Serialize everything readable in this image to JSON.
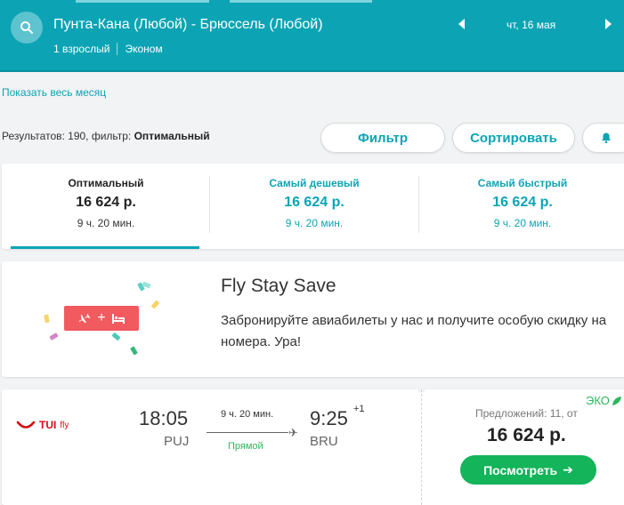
{
  "header": {
    "route": "Пунта-Кана (Любой) - Брюссель (Любой)",
    "passengers": "1 взрослый",
    "cabin": "Эконом",
    "date": "чт, 16 мая"
  },
  "links": {
    "show_month": "Показать весь месяц"
  },
  "results": {
    "prefix": "Результатов: 190, фильтр: ",
    "filter_name": "Оптимальный"
  },
  "buttons": {
    "filter": "Фильтр",
    "sort": "Сортировать"
  },
  "sort_tabs": [
    {
      "name": "Оптимальный",
      "price": "16 624 р.",
      "duration": "9 ч. 20 мин."
    },
    {
      "name": "Самый дешевый",
      "price": "16 624 р.",
      "duration": "9 ч. 20 мин."
    },
    {
      "name": "Самый быстрый",
      "price": "16 624 р.",
      "duration": "9 ч. 20 мин."
    }
  ],
  "promo": {
    "title": "Fly Stay Save",
    "text": "Забронируйте авиабилеты у нас и получите особую скидку на номера. Ура!",
    "plus": "+"
  },
  "flight": {
    "airline_logo": "TUI",
    "airline_logo_suffix": "fly",
    "dep_time": "18:05",
    "dep_code": "PUJ",
    "duration": "9 ч. 20 мин.",
    "stops": "Прямой",
    "arr_time": "9:25",
    "arr_day_offset": "+1",
    "arr_code": "BRU",
    "eco": "ЭКО",
    "offers": "Предложений: 11, от",
    "price": "16 624 р.",
    "view_label": "Посмотреть",
    "view_arrow": "➔"
  },
  "colors": {
    "accent": "#0ca4b4",
    "green": "#14b45a",
    "promo_red": "#f15a5e"
  }
}
